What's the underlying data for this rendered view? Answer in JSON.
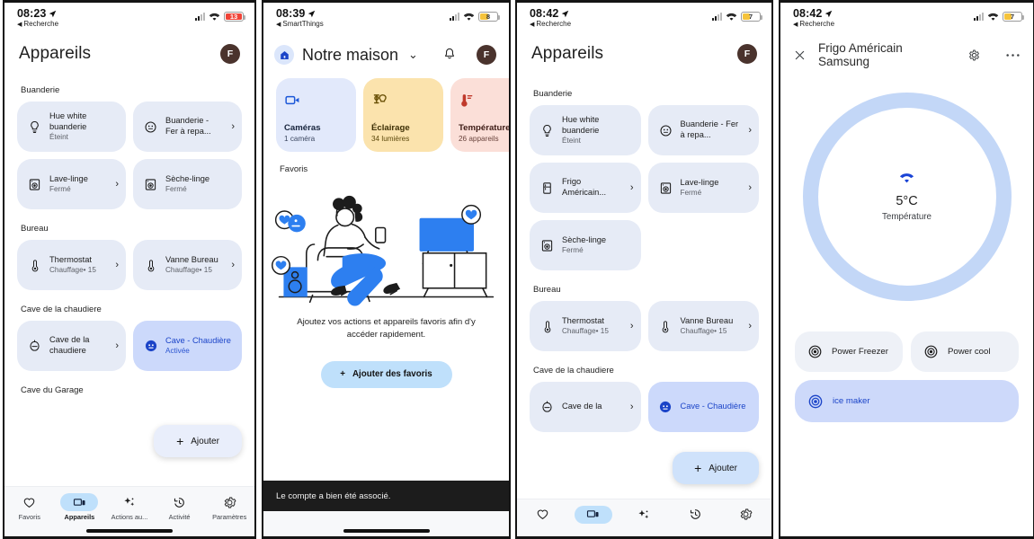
{
  "panels": {
    "p1": {
      "status": {
        "time": "08:23",
        "back": "Recherche",
        "battery": "13",
        "battery_color": "#f04438"
      },
      "title": "Appareils",
      "avatar": "F",
      "sections": [
        {
          "label": "Buanderie",
          "cards": [
            {
              "icon": "bulb-icon",
              "name": "Hue white buanderie",
              "sub": "Éteint",
              "chevron": false
            },
            {
              "icon": "outlet-icon",
              "name": "Buanderie - Fer à repa...",
              "sub": "",
              "chevron": true
            },
            {
              "icon": "washer-icon",
              "name": "Lave-linge",
              "sub": "Fermé",
              "chevron": true
            },
            {
              "icon": "dryer-icon",
              "name": "Sèche-linge",
              "sub": "Fermé",
              "chevron": false
            }
          ]
        },
        {
          "label": "Bureau",
          "cards": [
            {
              "icon": "thermostat-icon",
              "name": "Thermostat",
              "sub": "Chauffage",
              "meta": "• 15",
              "chevron": true
            },
            {
              "icon": "thermostat-icon",
              "name": "Vanne Bureau",
              "sub": "Chauffage",
              "meta": "• 15",
              "chevron": true
            }
          ]
        },
        {
          "label": "Cave de la chaudiere",
          "cards": [
            {
              "icon": "valve-icon",
              "name": "Cave de la chaudiere",
              "sub": "",
              "chevron": true
            },
            {
              "icon": "outlet-filled-icon",
              "name": "Cave - Chaudière",
              "sub": "Activée",
              "chevron": false,
              "active": true
            }
          ]
        },
        {
          "label": "Cave du Garage",
          "cards": []
        }
      ],
      "add_popup": "Ajouter",
      "nav": [
        {
          "icon": "heart-icon",
          "label": "Favoris",
          "selected": false
        },
        {
          "icon": "devices-icon",
          "label": "Appareils",
          "selected": true
        },
        {
          "icon": "automations-icon",
          "label": "Actions au...",
          "selected": false
        },
        {
          "icon": "history-icon",
          "label": "Activité",
          "selected": false
        },
        {
          "icon": "gear-icon",
          "label": "Paramètres",
          "selected": false
        }
      ]
    },
    "p2": {
      "status": {
        "time": "08:39",
        "back": "SmartThings",
        "battery": "8",
        "battery_color": "#f5c33b"
      },
      "home_title": "Notre maison",
      "avatar": "F",
      "chips": [
        {
          "icon": "camera-icon",
          "title": "Caméras",
          "sub": "1 caméra",
          "bg": "#e2e9fb",
          "fg": "#1b57d8"
        },
        {
          "icon": "lamp-icon",
          "title": "Éclairage",
          "sub": "34 lumières",
          "bg": "#fbe3ad",
          "fg": "#6b5208"
        },
        {
          "icon": "thermometer-icon",
          "title": "Température",
          "sub": "26 appareils",
          "bg": "#fbdfd8",
          "fg": "#c0392b"
        }
      ],
      "favorites_label": "Favoris",
      "empty_text": "Ajoutez vos actions et appareils favoris afin d'y accéder rapidement.",
      "add_favorites_button": "Ajouter des favoris",
      "toast": "Le compte a bien été associé."
    },
    "p3": {
      "status": {
        "time": "08:42",
        "back": "Recherche",
        "battery": "7",
        "battery_color": "#f5c33b"
      },
      "title": "Appareils",
      "avatar": "F",
      "sections": [
        {
          "label": "Buanderie",
          "cards": [
            {
              "icon": "bulb-icon",
              "name": "Hue white buanderie",
              "sub": "Éteint",
              "chevron": false
            },
            {
              "icon": "outlet-icon",
              "name": "Buanderie - Fer à repa...",
              "sub": "",
              "chevron": true
            },
            {
              "icon": "fridge-icon",
              "name": "Frigo Américain...",
              "sub": "",
              "chevron": true
            },
            {
              "icon": "washer-icon",
              "name": "Lave-linge",
              "sub": "Fermé",
              "chevron": true
            },
            {
              "icon": "dryer-icon",
              "name": "Sèche-linge",
              "sub": "Fermé",
              "chevron": false
            }
          ]
        },
        {
          "label": "Bureau",
          "cards": [
            {
              "icon": "thermostat-icon",
              "name": "Thermostat",
              "sub": "Chauffage",
              "meta": "• 15",
              "chevron": true
            },
            {
              "icon": "thermostat-icon",
              "name": "Vanne Bureau",
              "sub": "Chauffage",
              "meta": "• 15",
              "chevron": true
            }
          ]
        },
        {
          "label": "Cave de la chaudiere",
          "cards": [
            {
              "icon": "valve-icon",
              "name": "Cave de la",
              "sub": "",
              "chevron": true
            },
            {
              "icon": "outlet-filled-icon",
              "name": "Cave - Chaudière",
              "sub": "",
              "chevron": false,
              "active": true
            }
          ]
        }
      ],
      "add_popup": "Ajouter",
      "nav": [
        {
          "icon": "heart-icon",
          "label": "",
          "selected": false
        },
        {
          "icon": "devices-icon",
          "label": "",
          "selected": true
        },
        {
          "icon": "automations-icon",
          "label": "",
          "selected": false
        },
        {
          "icon": "history-icon",
          "label": "",
          "selected": false
        },
        {
          "icon": "gear-icon",
          "label": "",
          "selected": false
        }
      ]
    },
    "p4": {
      "status": {
        "time": "08:42",
        "back": "Recherche",
        "battery": "7",
        "battery_color": "#f5c33b"
      },
      "device_title": "Frigo Américain Samsung",
      "ring": {
        "value": "5°C",
        "label": "Température",
        "ring_color": "#c3d7f7"
      },
      "functions": [
        {
          "icon": "power-icon",
          "label": "Power Freezer",
          "on": false
        },
        {
          "icon": "power-icon",
          "label": "Power cool",
          "on": false
        }
      ],
      "wide_function": {
        "icon": "power-icon",
        "label": "ice maker",
        "on": true
      }
    }
  }
}
